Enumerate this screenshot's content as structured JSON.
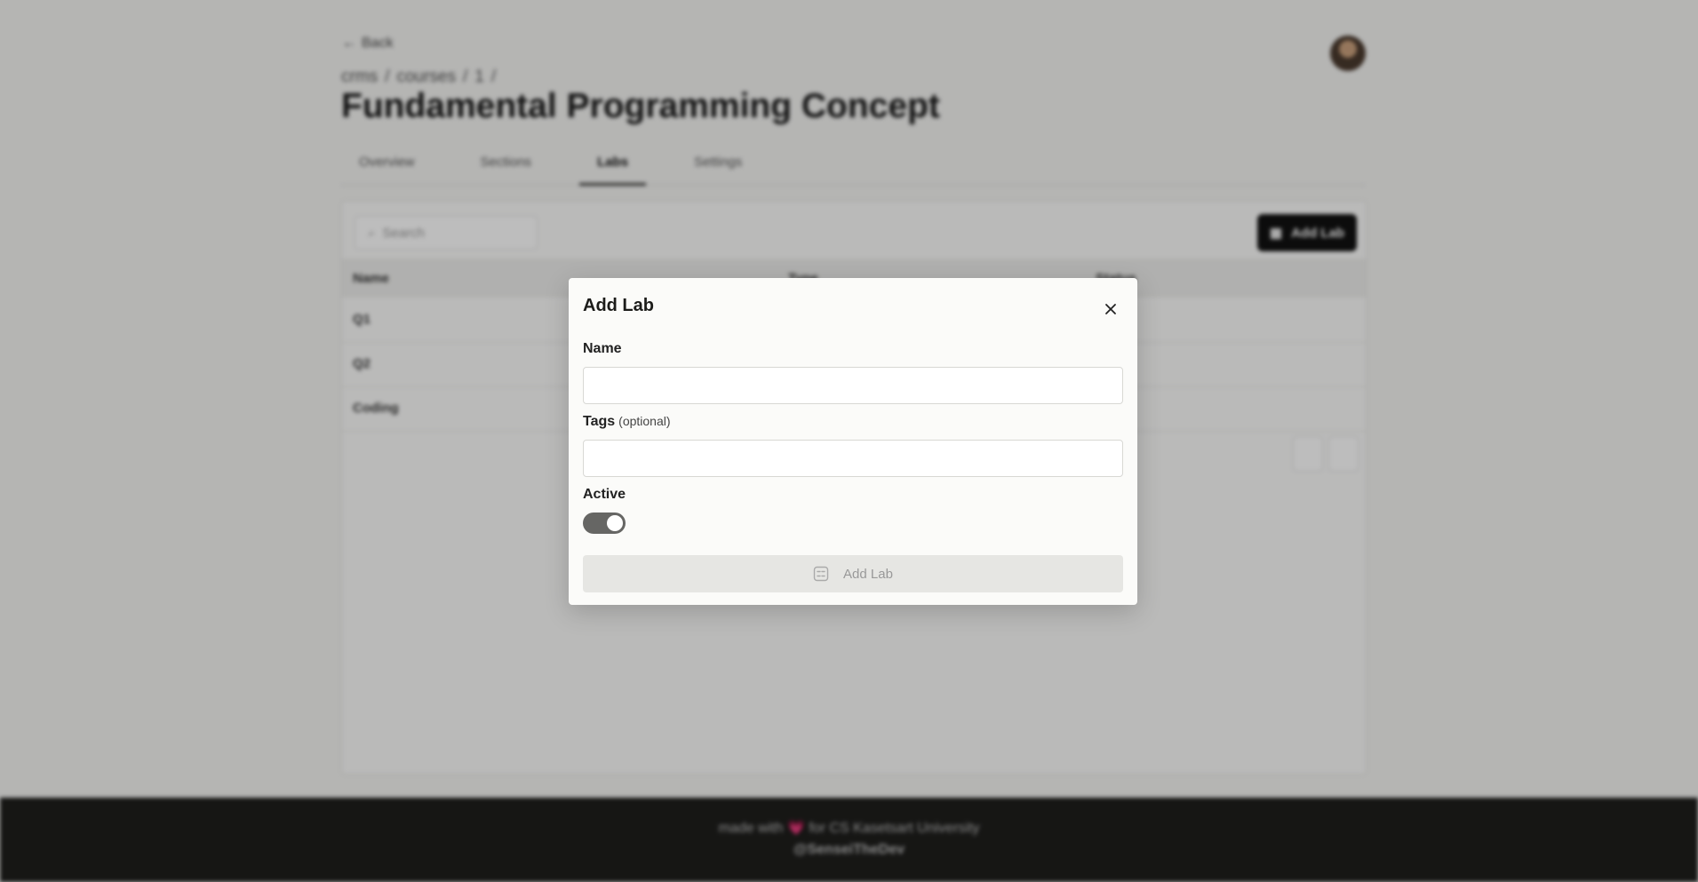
{
  "background": {
    "back_label": "Back",
    "breadcrumb": [
      "crms",
      "courses",
      "1"
    ],
    "course_title": "Fundamental Programming Concept",
    "tabs": [
      {
        "label": "Overview"
      },
      {
        "label": "Sections"
      },
      {
        "label": "Labs"
      },
      {
        "label": "Settings"
      }
    ],
    "active_tab": "Labs",
    "search_placeholder": "Search",
    "add_lab_button": "Add Lab",
    "columns": {
      "name": "Name",
      "type": "Type",
      "status": "Status"
    },
    "rows": [
      {
        "name": "Q1"
      },
      {
        "name": "Q2"
      },
      {
        "name": "Coding"
      }
    ],
    "footer": {
      "made_with": "made with",
      "heart": "💗",
      "for_text": "for CS Kasetsart University",
      "handle": "@SenseiTheDev"
    }
  },
  "modal": {
    "title": "Add Lab",
    "name_label": "Name",
    "name_value": "",
    "tags_label": "Tags",
    "tags_optional": "(optional)",
    "tags_value": "",
    "active_label": "Active",
    "active": true,
    "submit_label": "Add Lab",
    "submit_enabled": false
  },
  "colors": {
    "overlay": "#000000",
    "modal_bg": "#fbfbf9",
    "toggle_on": "#666664",
    "footer_bg": "#1e1e1c",
    "accent_dark": "#111111"
  },
  "icons": [
    "back-arrow-icon",
    "search-icon",
    "add-lab-icon",
    "close-icon",
    "lab-icon"
  ]
}
